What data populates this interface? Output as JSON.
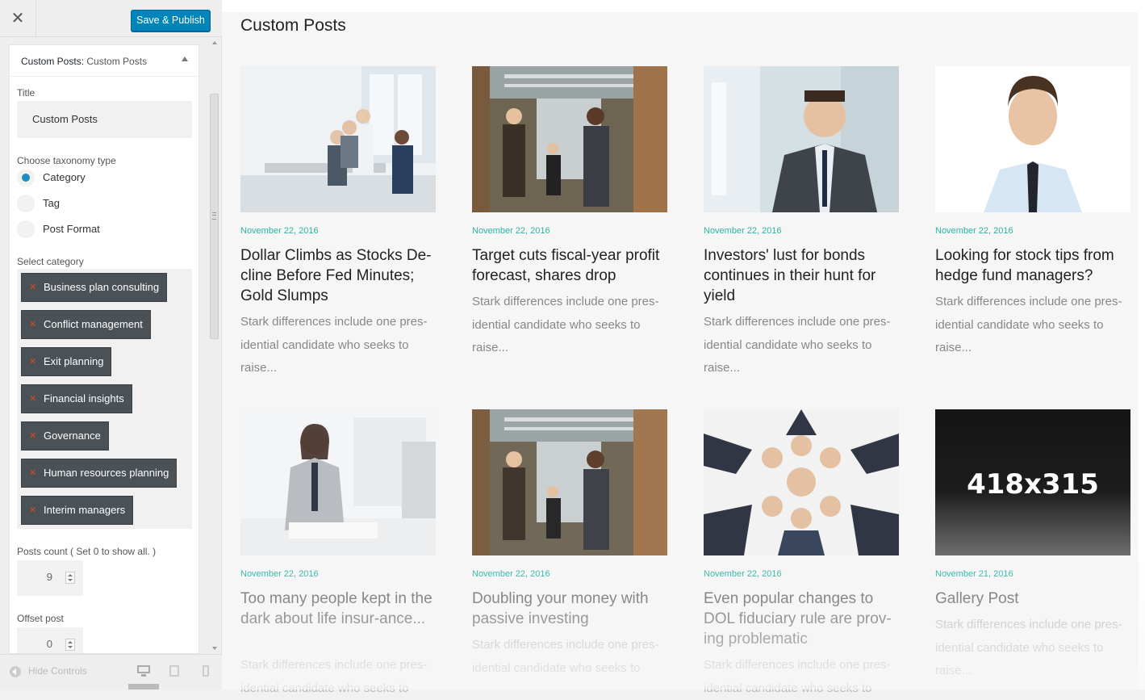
{
  "panel": {
    "close_label": "✕",
    "publish_label": "Save & Publish",
    "widget": {
      "title_main": "Custom Posts:",
      "title_sub": "Custom Posts"
    },
    "fields": {
      "title_label": "Title",
      "title_value": "Custom Posts",
      "taxonomy_label": "Choose taxonomy type",
      "taxonomy_options": [
        "Category",
        "Tag",
        "Post Format"
      ],
      "taxonomy_selected": "Category",
      "category_label": "Select category",
      "categories": [
        "Business plan consulting",
        "Conflict management",
        "Exit planning",
        "Financial insights",
        "Governance",
        "Human resources planning",
        "Interim managers"
      ],
      "posts_count_label": "Posts count ( Set 0 to show all. )",
      "posts_count_value": "9",
      "offset_label": "Offset post",
      "offset_value": "0"
    },
    "footer": {
      "hide_controls_label": "Hide Controls"
    }
  },
  "preview": {
    "section_title": "Custom Posts",
    "placeholder_text": "418x315",
    "posts": [
      {
        "date": "November 22, 2016",
        "title": "Dollar Climbs as Stocks De-cline Before Fed Minutes; Gold Slumps",
        "excerpt": "Stark differences include one pres-idential candidate who seeks to raise..."
      },
      {
        "date": "November 22, 2016",
        "title": "Target cuts fiscal-year profit forecast, shares drop",
        "excerpt": "Stark differences include one pres-idential candidate who seeks to raise..."
      },
      {
        "date": "November 22, 2016",
        "title": "Investors' lust for bonds continues in their hunt for yield",
        "excerpt": "Stark differences include one pres-idential candidate who seeks to raise..."
      },
      {
        "date": "November 22, 2016",
        "title": "Looking for stock tips from hedge fund managers?",
        "excerpt": "Stark differences include one pres-idential candidate who seeks to raise..."
      },
      {
        "date": "November 22, 2016",
        "title": "Too many people kept in the dark about life insur-ance...",
        "excerpt": "Stark differences include one pres-idential candidate who seeks to"
      },
      {
        "date": "November 22, 2016",
        "title": "Doubling your money with passive investing",
        "excerpt": "Stark differences include one pres-idential candidate who seeks to"
      },
      {
        "date": "November 22, 2016",
        "title": "Even popular changes to DOL fiduciary rule are prov-ing problematic",
        "excerpt": "Stark differences include one pres-idential candidate who seeks to"
      },
      {
        "date": "November 21, 2016",
        "title": "Gallery Post",
        "excerpt": "Stark differences include one pres-idential candidate who seeks to raise..."
      }
    ]
  }
}
